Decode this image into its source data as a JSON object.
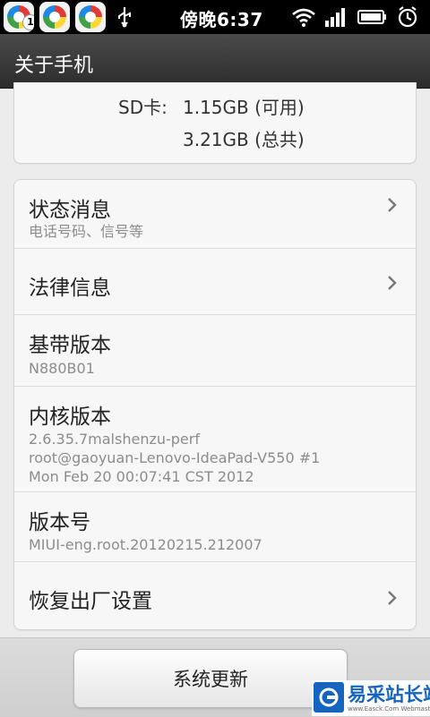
{
  "status_bar": {
    "time": "傍晚6:37",
    "notification_badge": "1",
    "icons": [
      "app-store-icon",
      "app-store-icon",
      "app-store-icon",
      "usb-icon",
      "wifi-icon",
      "signal-icon",
      "battery-icon",
      "alarm-icon"
    ]
  },
  "header": {
    "title": "关于手机"
  },
  "storage": {
    "sd_label": "SD卡:",
    "available": "1.15GB (可用)",
    "total": "3.21GB (总共)"
  },
  "items": [
    {
      "title": "状态消息",
      "subtitle": "电话号码、信号等",
      "chevron": true
    },
    {
      "title": "法律信息",
      "chevron": true
    },
    {
      "title": "基带版本",
      "subtitle": "N880B01",
      "chevron": false
    },
    {
      "title": "内核版本",
      "subtitle_lines": [
        "2.6.35.7malshenzu-perf",
        "root@gaoyuan-Lenovo-IdeaPad-V550 #1",
        "Mon Feb 20 00:07:41 CST 2012"
      ],
      "chevron": false
    },
    {
      "title": "版本号",
      "subtitle": "MIUI-eng.root.20120215.212007",
      "chevron": false
    },
    {
      "title": "恢复出厂设置",
      "chevron": true
    }
  ],
  "footer": {
    "update_button": "系统更新"
  },
  "watermark": {
    "text": "易采站长站",
    "url": "www.Easck.Com Webmaster"
  },
  "colors": {
    "accent": "#1565c0",
    "subtitle": "#8c8c8c"
  }
}
